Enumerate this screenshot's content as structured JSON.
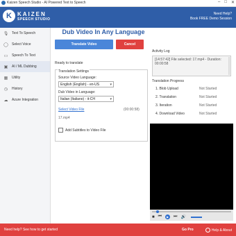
{
  "window": {
    "title": "Kaizen Speech Studio - AI Powered Text to Speech",
    "controls": [
      "–",
      "□",
      "✕"
    ]
  },
  "header": {
    "logo_main": "KAIZEN",
    "logo_sub": "SPEECH STUDIO",
    "logo_mark": "K",
    "help_line1": "Need Help?",
    "help_line2": "Book FREE Demo Session"
  },
  "sidebar": {
    "items": [
      {
        "label": "Text To Speech",
        "icon": "microphone-icon",
        "glyph": "🎙"
      },
      {
        "label": "Select Voice",
        "icon": "person-icon",
        "glyph": "◯"
      },
      {
        "label": "Speech To Text",
        "icon": "document-icon",
        "glyph": "▭"
      },
      {
        "label": "AI / ML Dubbing",
        "icon": "dubbing-icon",
        "glyph": "▣"
      },
      {
        "label": "Utility",
        "icon": "grid-icon",
        "glyph": "▦"
      },
      {
        "label": "History",
        "icon": "history-icon",
        "glyph": "◷"
      },
      {
        "label": "Azure Integration",
        "icon": "cloud-icon",
        "glyph": "☁"
      }
    ],
    "active_index": 3
  },
  "main": {
    "title": "Dub Video In Any Language",
    "translate_button": "Translate Video",
    "cancel_button": "Cancel",
    "status": "Ready to translate",
    "settings": {
      "legend": "Translation Settings",
      "source_label": "Source Video Language:",
      "source_value": "English (English) - en-US",
      "dub_label": "Dub Video in Language:",
      "dub_value": "Italian (Italiano) - it-CH",
      "select_video_link": "Select Video File",
      "duration": "(00:00:58)",
      "file_name": "17.mp4",
      "subtitles_label": "Add Subtitles to Video File",
      "subtitles_checked": false
    },
    "activity_log": {
      "title": "Activity Log",
      "text": "[14:57:42] File selected: 17.mp4 - Duration: 00:00:58"
    },
    "progress": {
      "title": "Translation Progress",
      "steps": [
        {
          "label": "1. Blob Upload",
          "status": "Not Started"
        },
        {
          "label": "2. Translation",
          "status": "Not Started"
        },
        {
          "label": "3. Iteration",
          "status": "Not Started"
        },
        {
          "label": "4. Download Video",
          "status": "Not Started"
        }
      ]
    }
  },
  "footer": {
    "left": "Need help? See how to get started",
    "gopro": "Go Pro",
    "help": "Help & About"
  },
  "colors": {
    "brand": "#2f5ea8",
    "primary_button": "#4a86d9",
    "danger": "#e0413f",
    "active_nav": "#e3e8f2"
  }
}
